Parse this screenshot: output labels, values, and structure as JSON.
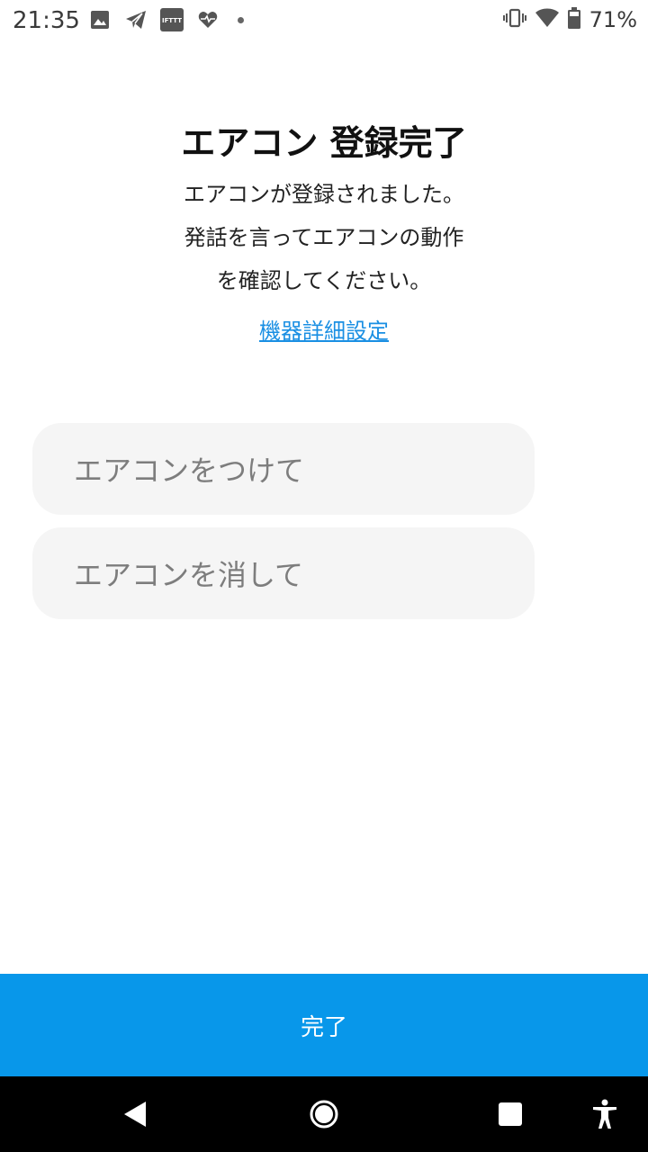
{
  "status_bar": {
    "time": "21:35",
    "battery_percent": "71%",
    "left_icons": [
      "image-icon",
      "telegram-icon",
      "ifttt-icon",
      "heart-pulse-icon",
      "notification-dot"
    ],
    "ifttt_label": "IFTTT",
    "right_icons": [
      "vibrate-icon",
      "wifi-icon",
      "battery-icon"
    ]
  },
  "main": {
    "title": "エアコン 登録完了",
    "description_lines": [
      "エアコンが登録されました。",
      "発話を言ってエアコンの動作",
      "を確認してください。"
    ],
    "device_settings_link": "機器詳細設定",
    "phrases": [
      "エアコンをつけて",
      "エアコンを消して"
    ]
  },
  "footer": {
    "done_label": "完了",
    "accent_color": "#0897ea"
  },
  "nav_bar": {
    "icons": [
      "back-icon",
      "home-icon",
      "recents-icon",
      "accessibility-icon"
    ]
  }
}
